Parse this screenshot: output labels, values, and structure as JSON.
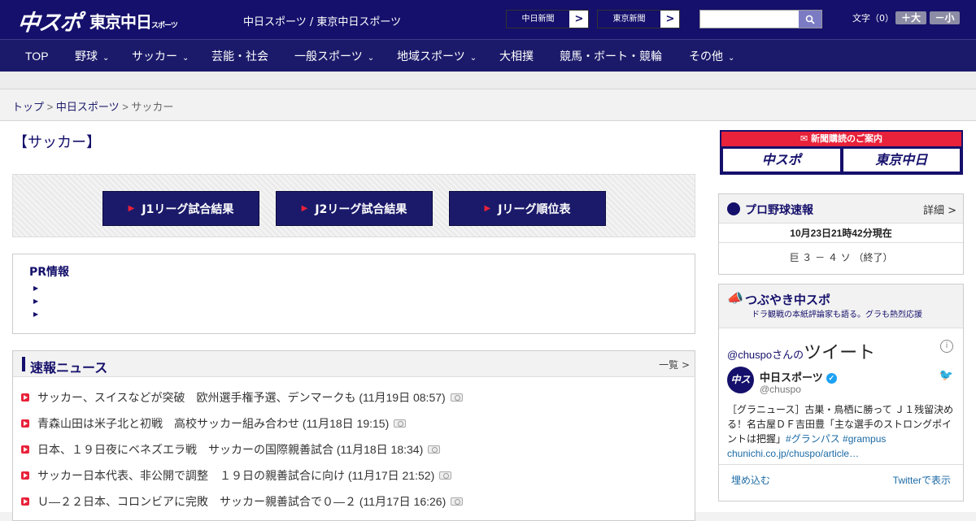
{
  "header": {
    "logo_chunichi_sports": "中スポ",
    "logo_tokyo_chunichi": "東京中日",
    "logo_tokyo_chunichi_small": "スポーツ",
    "site_names": "中日スポーツ / 東京中日スポーツ",
    "paper_links": [
      {
        "label": "中日新聞",
        "arrow": ">"
      },
      {
        "label": "東京新聞",
        "arrow": ">"
      }
    ],
    "search": {
      "placeholder": ""
    },
    "font_size_label": "文字（0）",
    "font_larger": "＋大",
    "font_smaller": "－小"
  },
  "nav": {
    "items": [
      {
        "label": "TOP"
      },
      {
        "label": "野球",
        "dropdown": true
      },
      {
        "label": "サッカー",
        "dropdown": true
      },
      {
        "label": "芸能・社会"
      },
      {
        "label": "一般スポーツ",
        "dropdown": true
      },
      {
        "label": "地域スポーツ",
        "dropdown": true
      },
      {
        "label": "大相撲"
      },
      {
        "label": "競馬・ボート・競輪"
      },
      {
        "label": "その他",
        "dropdown": true
      }
    ]
  },
  "breadcrumb": {
    "top": "トップ",
    "sep1": " > ",
    "middle": "中日スポーツ",
    "sep2": " > ",
    "current": "サッカー"
  },
  "page": {
    "title": "【サッカー】"
  },
  "jleague_buttons": [
    {
      "label": "J1リーグ試合結果"
    },
    {
      "label": "J2リーグ試合結果"
    },
    {
      "label": "Jリーグ順位表"
    }
  ],
  "pr": {
    "title": "PR情報"
  },
  "news": {
    "title": "速報ニュース",
    "more": "一覧 >",
    "items": [
      {
        "text": "サッカー、スイスなどが突破　欧州選手権予選、デンマークも (11月19日 08:57)"
      },
      {
        "text": "青森山田は米子北と初戦　高校サッカー組み合わせ (11月18日 19:15)"
      },
      {
        "text": "日本、１９日夜にベネズエラ戦　サッカーの国際親善試合 (11月18日 18:34)"
      },
      {
        "text": "サッカー日本代表、非公開で調整　１９日の親善試合に向け (11月17日 21:52)"
      },
      {
        "text": "Ｕ―２２日本、コロンビアに完敗　サッカー親善試合で０―２ (11月17日 16:26)"
      }
    ]
  },
  "subscription": {
    "title": "新聞購読のご案内",
    "buttons": [
      "中スポ",
      "東京中日"
    ]
  },
  "baseball": {
    "title": "プロ野球速報",
    "detail": "詳細 >",
    "as_of": "10月23日21時42分現在",
    "score": "巨 ３ － ４ ソ （終了）"
  },
  "tweets": {
    "panel_title": "つぶやき中スポ",
    "panel_sub": "ドラ観戦の本紙評論家も語る。グラも熱烈応援",
    "handle_prefix": "@chuspo",
    "handle_suffix": "さんの",
    "heading": "ツイート",
    "info": "i",
    "avatar_text": "中スポ",
    "name": "中日スポーツ",
    "handle": "@chuspo",
    "body": "［グラニュース］古巣・鳥栖に勝って Ｊ１残留決める！名古屋ＤＦ吉田豊「主な選手のストロングポイントは把握」",
    "hashtags": "#グランパス #grampus",
    "link": "chunichi.co.jp/chuspo/article…",
    "embed": "埋め込む",
    "view_on_twitter": "Twitterで表示"
  },
  "colors": {
    "brand_navy": "#15106b",
    "accent_red": "#e8223a"
  }
}
